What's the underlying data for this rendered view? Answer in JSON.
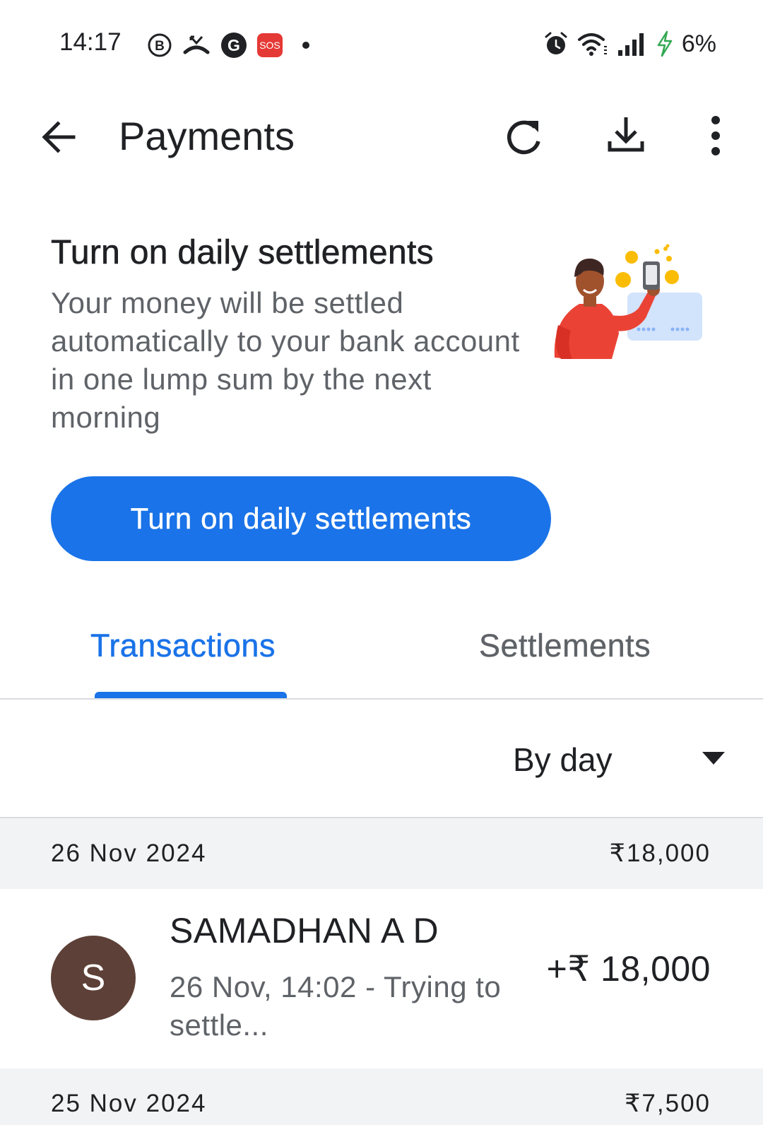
{
  "status_bar": {
    "time": "14:17",
    "sos_label": "SOS",
    "battery": "6%"
  },
  "app_bar": {
    "title": "Payments"
  },
  "promo": {
    "title": "Turn on daily settlements",
    "description": "Your money will be settled automatically to your bank account in one lump sum by the next morning",
    "button_label": "Turn on daily settlements"
  },
  "tabs": [
    {
      "label": "Transactions",
      "selected": true
    },
    {
      "label": "Settlements",
      "selected": false
    }
  ],
  "filter": {
    "selected": "By day"
  },
  "days": [
    {
      "date": "26 Nov 2024",
      "total": "₹18,000",
      "transactions": [
        {
          "initial": "S",
          "name": "SAMADHAN A D",
          "subtitle": "26 Nov, 14:02 - Trying to settle...",
          "amount": "+₹ 18,000"
        }
      ]
    },
    {
      "date": "25 Nov 2024",
      "total": "₹7,500"
    }
  ],
  "colors": {
    "accent": "#1a73e8",
    "avatar": "#5d4037",
    "group_header_bg": "#f1f3f4",
    "sos": "#e53935",
    "charging": "#34a853"
  },
  "icons": {
    "back": "arrow-left-icon",
    "refresh": "refresh-icon",
    "download": "download-icon",
    "more": "more-vert-icon",
    "dropdown": "triangle-down-icon"
  }
}
